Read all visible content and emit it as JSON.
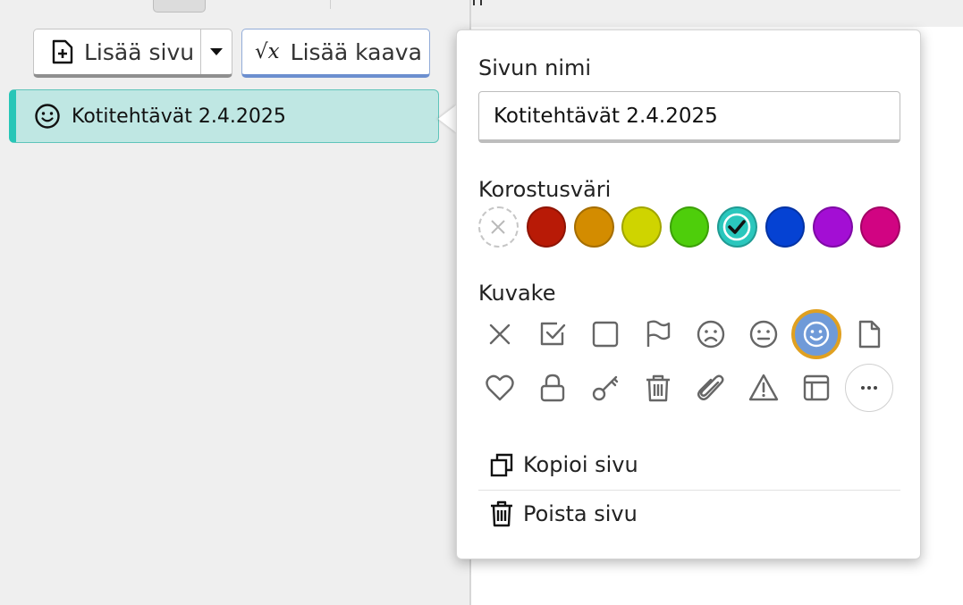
{
  "toolbar": {
    "add_page_label": "Lisää sivu",
    "add_formula_label": "Lisää kaava",
    "formula_icon_text": "√x"
  },
  "page_list": {
    "items": [
      {
        "title": "Kotitehtävät 2.4.2025",
        "icon": "smiley-icon",
        "highlight_color": "#27c6b7",
        "selected": true
      }
    ]
  },
  "page_settings": {
    "name_label": "Sivun nimi",
    "name_value": "Kotitehtävät 2.4.2025",
    "color_label": "Korostusväri",
    "colors": [
      {
        "id": "none",
        "hex": ""
      },
      {
        "id": "red",
        "hex": "#b81a06"
      },
      {
        "id": "orange",
        "hex": "#d38c00"
      },
      {
        "id": "yellow",
        "hex": "#cfd400"
      },
      {
        "id": "green",
        "hex": "#4ece0b"
      },
      {
        "id": "teal",
        "hex": "#2ac7bd",
        "selected": true
      },
      {
        "id": "blue",
        "hex": "#0542d3"
      },
      {
        "id": "purple",
        "hex": "#a30ed4"
      },
      {
        "id": "magenta",
        "hex": "#d10482"
      }
    ],
    "icon_label": "Kuvake",
    "icons": [
      "none-icon",
      "checkbox-checked-icon",
      "checkbox-empty-icon",
      "flag-icon",
      "sad-face-icon",
      "neutral-face-icon",
      "smiley-icon",
      "document-icon",
      "heart-icon",
      "lock-icon",
      "key-icon",
      "trash-icon",
      "paperclip-icon",
      "warning-icon",
      "table-icon",
      "more-icon"
    ],
    "selected_icon": "smiley-icon",
    "copy_label": "Kopioi sivu",
    "delete_label": "Poista sivu"
  }
}
